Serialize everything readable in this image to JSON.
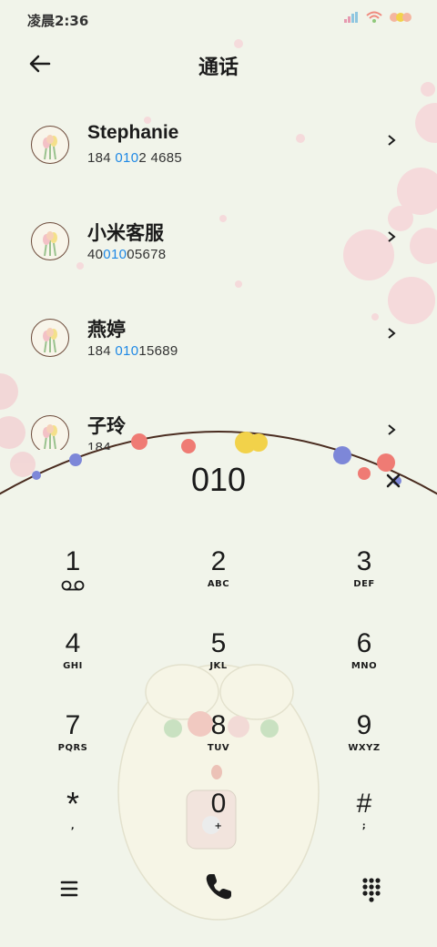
{
  "status": {
    "time": "凌晨2:36"
  },
  "header": {
    "title": "通话"
  },
  "contacts": [
    {
      "name": "Stephanie",
      "num_pre": "184 ",
      "num_hl": "010",
      "num_post": "2 4685"
    },
    {
      "name": "小米客服",
      "num_pre": "40",
      "num_hl": "010",
      "num_post": "05678"
    },
    {
      "name": "燕婷",
      "num_pre": "184 ",
      "num_hl": "010",
      "num_post": "15689"
    },
    {
      "name": "子玲",
      "num_pre": "184 ",
      "num_hl": "",
      "num_post": ""
    }
  ],
  "dialer": {
    "input": "010",
    "keys": [
      {
        "digit": "1",
        "letters": ""
      },
      {
        "digit": "2",
        "letters": "ABC"
      },
      {
        "digit": "3",
        "letters": "DEF"
      },
      {
        "digit": "4",
        "letters": "GHI"
      },
      {
        "digit": "5",
        "letters": "JKL"
      },
      {
        "digit": "6",
        "letters": "MNO"
      },
      {
        "digit": "7",
        "letters": "PQRS"
      },
      {
        "digit": "8",
        "letters": "TUV"
      },
      {
        "digit": "9",
        "letters": "WXYZ"
      },
      {
        "digit": "*",
        "letters": ","
      },
      {
        "digit": "0",
        "letters": "+"
      },
      {
        "digit": "#",
        "letters": ";"
      }
    ]
  },
  "colors": {
    "accent": "#1e88e5",
    "call": "#1b1b1b",
    "arc": "#4a2c20",
    "background": "#f1f4ea"
  }
}
